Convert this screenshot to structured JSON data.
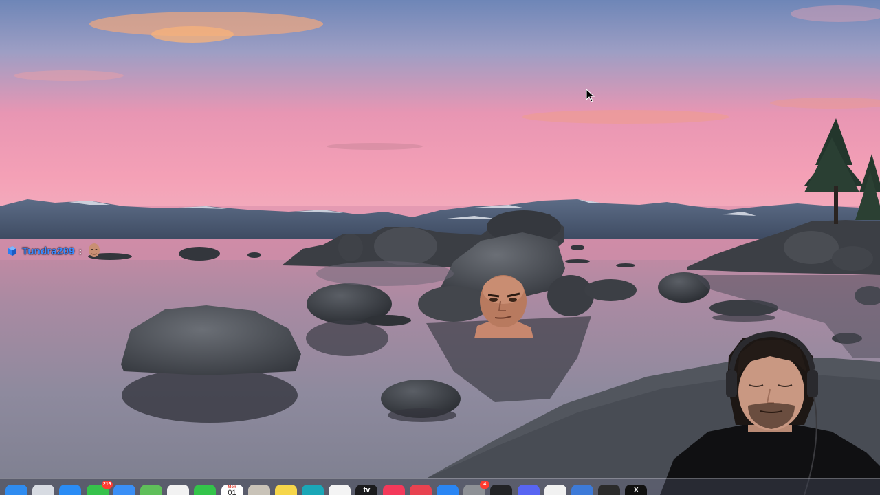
{
  "chat": {
    "username": "Tundra209",
    "separator": ":",
    "username_color": "#3b8cff",
    "cube_icon": "cube-icon",
    "emote_icon": "face-emote-icon"
  },
  "overlays": {
    "meme_face_icon": "face-sticker-icon",
    "webcam_label": "webcam-feed"
  },
  "dock": {
    "items": [
      {
        "name": "finder",
        "icon": "finder-icon",
        "color": "#2f8cf0",
        "glyph": "",
        "badge": ""
      },
      {
        "name": "launchpad",
        "icon": "launchpad-icon",
        "color": "#d7dbe2",
        "glyph": "",
        "badge": ""
      },
      {
        "name": "safari",
        "icon": "safari-icon",
        "color": "#2a8cf5",
        "glyph": "",
        "badge": ""
      },
      {
        "name": "messages",
        "icon": "messages-icon",
        "color": "#36c24b",
        "glyph": "",
        "badge": "216"
      },
      {
        "name": "mail",
        "icon": "mail-icon",
        "color": "#3a8ff6",
        "glyph": "",
        "badge": ""
      },
      {
        "name": "maps",
        "icon": "maps-icon",
        "color": "#5fbf5a",
        "glyph": "",
        "badge": ""
      },
      {
        "name": "photos",
        "icon": "photos-icon",
        "color": "#f2f2f2",
        "glyph": "",
        "badge": ""
      },
      {
        "name": "facetime",
        "icon": "facetime-icon",
        "color": "#33c44a",
        "glyph": "",
        "badge": ""
      },
      {
        "name": "calendar",
        "icon": "calendar-icon",
        "color": "#ffffff",
        "glyph": "",
        "badge": "",
        "month": "Mon",
        "day": "01"
      },
      {
        "name": "contacts",
        "icon": "contacts-icon",
        "color": "#c9c3b8",
        "glyph": "",
        "badge": ""
      },
      {
        "name": "notes",
        "icon": "notes-icon",
        "color": "#f6d64a",
        "glyph": "",
        "badge": ""
      },
      {
        "name": "freeform",
        "icon": "freeform-icon",
        "color": "#1aa7b7",
        "glyph": "",
        "badge": ""
      },
      {
        "name": "reminders",
        "icon": "reminders-icon",
        "color": "#f4f4f4",
        "glyph": "",
        "badge": ""
      },
      {
        "name": "apple-tv",
        "icon": "apple-tv-icon",
        "color": "#1b1b1d",
        "glyph": "tv",
        "badge": ""
      },
      {
        "name": "music",
        "icon": "music-icon",
        "color": "#f4395a",
        "glyph": "",
        "badge": ""
      },
      {
        "name": "news",
        "icon": "news-icon",
        "color": "#e84250",
        "glyph": "",
        "badge": ""
      },
      {
        "name": "app-store",
        "icon": "app-store-icon",
        "color": "#2a86f4",
        "glyph": "",
        "badge": ""
      },
      {
        "name": "system-settings",
        "icon": "system-settings-icon",
        "color": "#8e9196",
        "glyph": "",
        "badge": "4"
      },
      {
        "name": "chatgpt",
        "icon": "chatgpt-icon",
        "color": "#222326",
        "glyph": "",
        "badge": ""
      },
      {
        "name": "discord",
        "icon": "discord-icon",
        "color": "#5865f2",
        "glyph": "",
        "badge": ""
      },
      {
        "name": "chrome",
        "icon": "chrome-icon",
        "color": "#f1f1f1",
        "glyph": "",
        "badge": ""
      },
      {
        "name": "preview",
        "icon": "preview-icon",
        "color": "#3d7ad8",
        "glyph": "",
        "badge": ""
      },
      {
        "name": "final-cut",
        "icon": "final-cut-icon",
        "color": "#2b2b2b",
        "glyph": "",
        "badge": ""
      },
      {
        "name": "x",
        "icon": "x-icon",
        "color": "#111111",
        "glyph": "X",
        "badge": ""
      }
    ]
  }
}
